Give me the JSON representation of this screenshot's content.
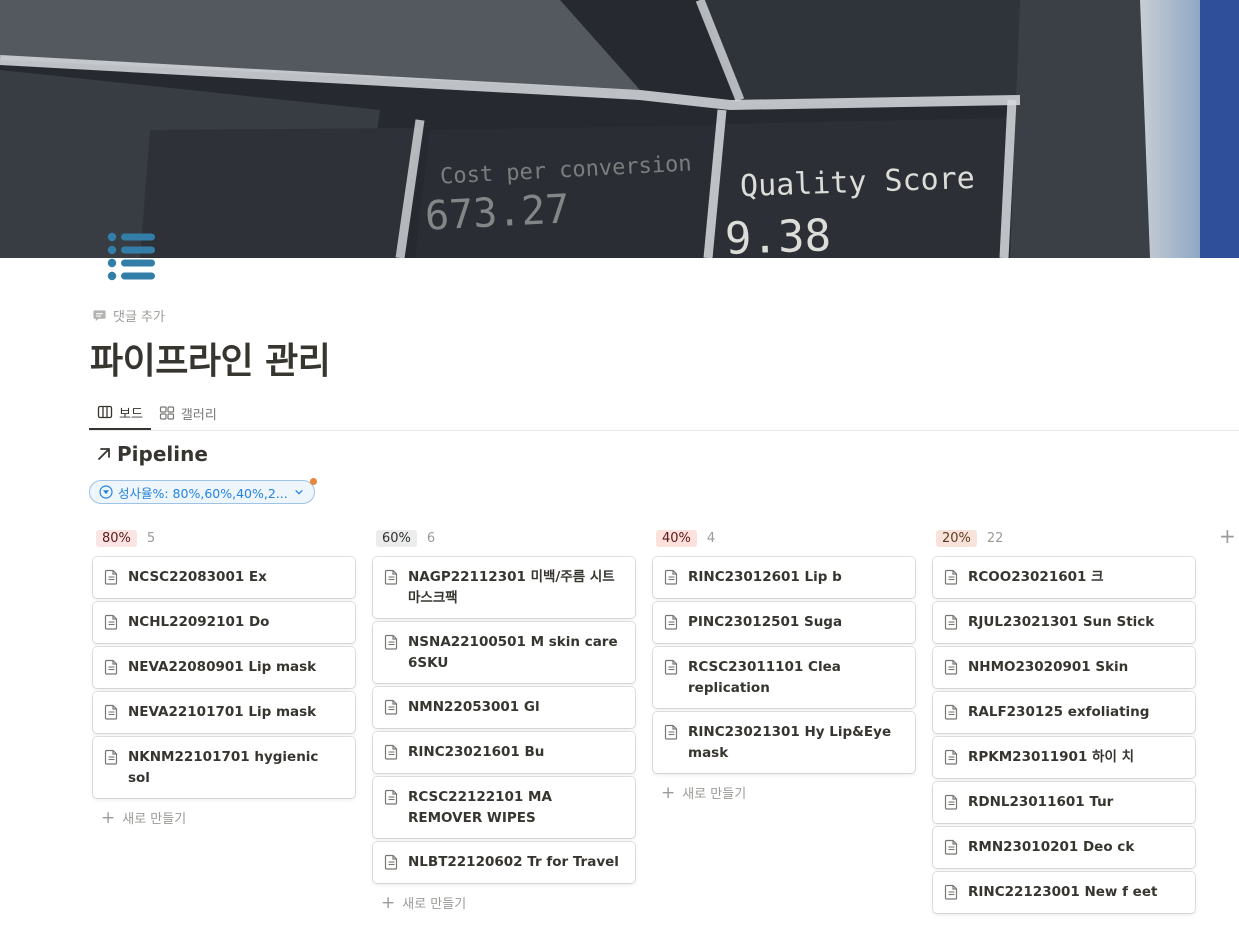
{
  "cover": {
    "texts": [
      "Cost per conversion",
      "673.27",
      "Quality Score",
      "9.38"
    ]
  },
  "page": {
    "icon": "list-icon",
    "comment_label": "댓글 추가",
    "title": "파이프라인 관리"
  },
  "views": [
    {
      "label": "보드",
      "icon": "board-icon",
      "active": true
    },
    {
      "label": "갤러리",
      "icon": "gallery-icon",
      "active": false
    }
  ],
  "database": {
    "title": "Pipeline",
    "title_icon": "arrow-up-right-icon"
  },
  "filter": {
    "label": "성사율%: 80%,60%,40%,2..."
  },
  "new_card_label": "새로 만들기",
  "add_group_label": "+",
  "colors": {
    "accent": "#2383e2",
    "tag_80": "#fbe4e4",
    "tag_60": "#ebeced",
    "tag_40": "#fce1dc",
    "tag_20": "#f8e3da"
  },
  "columns": [
    {
      "label": "80%",
      "count": "5",
      "cards": [
        "NCSC22083001 Ex",
        "NCHL22092101 Do",
        "NEVA22080901 Lip mask",
        "NEVA22101701 Lip mask",
        "NKNM22101701 hygienic sol"
      ]
    },
    {
      "label": "60%",
      "count": "6",
      "cards": [
        "NAGP22112301 미백/주름 시트마스크팩",
        "NSNA22100501 M skin care 6SKU",
        "NMN22053001 Gl",
        "RINC23021601 Bu",
        "RCSC22122101 MA REMOVER WIPES",
        "NLBT22120602 Tr for Travel"
      ]
    },
    {
      "label": "40%",
      "count": "4",
      "cards": [
        "RINC23012601 Lip b",
        "PINC23012501 Suga",
        "RCSC23011101 Clea replication",
        "RINC23021301 Hy Lip&Eye mask"
      ]
    },
    {
      "label": "20%",
      "count": "22",
      "cards": [
        "RCOO23021601 크",
        "RJUL23021301 Sun Stick",
        "NHMO23020901 Skin",
        "RALF230125 exfoliating",
        "RPKM23011901 하이 치",
        "RDNL23011601 Tur",
        "RMN23010201 Deo ck",
        "RINC22123001 New f eet"
      ]
    }
  ]
}
